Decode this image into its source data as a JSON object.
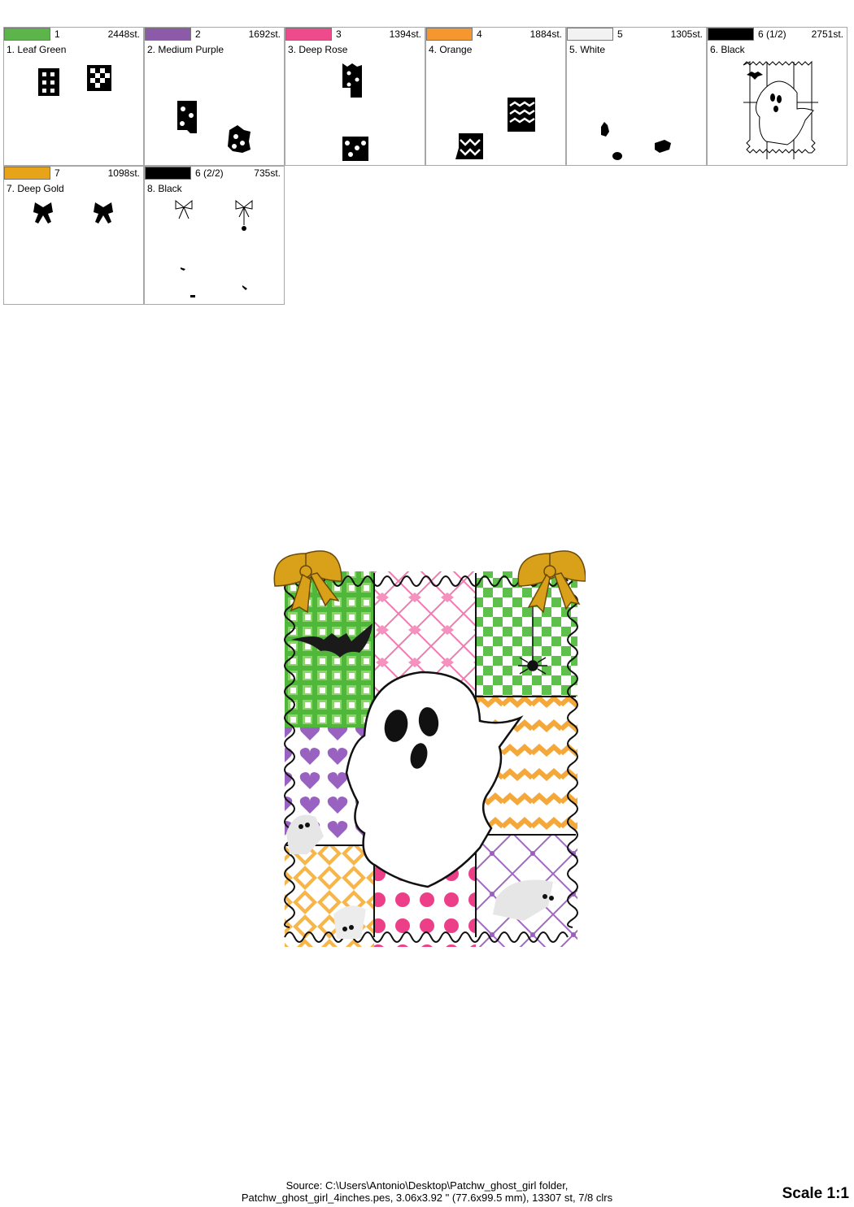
{
  "colors": [
    {
      "swatch": "#5cb54a",
      "index": "1",
      "stitches": "2448st.",
      "name": "1. Leaf Green"
    },
    {
      "swatch": "#8c5aa8",
      "index": "2",
      "stitches": "1692st.",
      "name": "2. Medium Purple"
    },
    {
      "swatch": "#ee4a8c",
      "index": "3",
      "stitches": "1394st.",
      "name": "3. Deep Rose"
    },
    {
      "swatch": "#f5962e",
      "index": "4",
      "stitches": "1884st.",
      "name": "4. Orange"
    },
    {
      "swatch": "#f2f2f2",
      "index": "5",
      "stitches": "1305st.",
      "name": "5. White"
    },
    {
      "swatch": "#000000",
      "index": "6 (1/2)",
      "stitches": "2751st.",
      "name": "6. Black"
    },
    {
      "swatch": "#e8a418",
      "index": "7",
      "stitches": "1098st.",
      "name": "7. Deep Gold"
    },
    {
      "swatch": "#000000",
      "index": "6 (2/2)",
      "stitches": "735st.",
      "name": "8. Black"
    }
  ],
  "footer": {
    "line1": "Source: C:\\Users\\Antonio\\Desktop\\Patchw_ghost_girl folder,",
    "line2": "Patchw_ghost_girl_4inches.pes, 3.06x3.92 \" (77.6x99.5 mm), 13307 st, 7/8 clrs"
  },
  "scale": "Scale 1:1"
}
